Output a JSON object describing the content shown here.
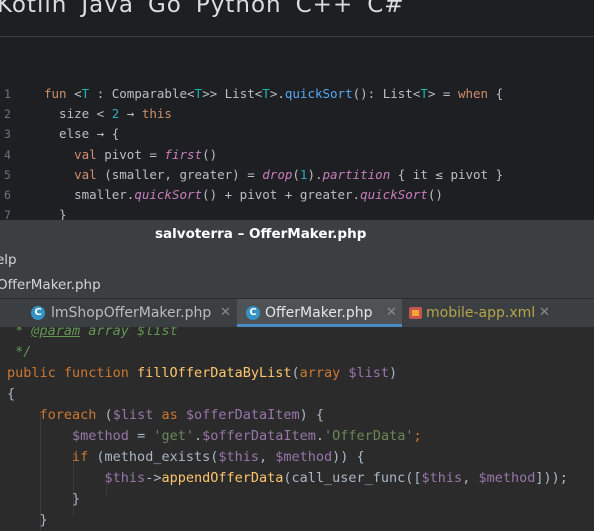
{
  "languages": [
    "Kotlin",
    "Java",
    "Go",
    "Python",
    "C++",
    "C#"
  ],
  "kotlin_snippet": {
    "line_numbers": [
      "1",
      "2",
      "3",
      "4",
      "5",
      "6",
      "7"
    ],
    "lines": [
      [
        {
          "t": "fun ",
          "c": "kw"
        },
        {
          "t": "<",
          "c": "pl"
        },
        {
          "t": "T",
          "c": "tp"
        },
        {
          "t": " : Comparable<",
          "c": "pl"
        },
        {
          "t": "T",
          "c": "tp"
        },
        {
          "t": ">> List<",
          "c": "pl"
        },
        {
          "t": "T",
          "c": "tp"
        },
        {
          "t": ">.",
          "c": "pl"
        },
        {
          "t": "quickSort",
          "c": "fn"
        },
        {
          "t": "(): List<",
          "c": "pl"
        },
        {
          "t": "T",
          "c": "tp"
        },
        {
          "t": "> = ",
          "c": "pl"
        },
        {
          "t": "when",
          "c": "kw"
        },
        {
          "t": " {",
          "c": "pl"
        }
      ],
      [
        {
          "t": "  size < ",
          "c": "pl"
        },
        {
          "t": "2",
          "c": "num"
        },
        {
          "t": " → ",
          "c": "pl"
        },
        {
          "t": "this",
          "c": "kw"
        }
      ],
      [
        {
          "t": "  else → {",
          "c": "pl"
        }
      ],
      [
        {
          "t": "    ",
          "c": "pl"
        },
        {
          "t": "val",
          "c": "kw"
        },
        {
          "t": " pivot = ",
          "c": "pl"
        },
        {
          "t": "first",
          "c": "it"
        },
        {
          "t": "()",
          "c": "pl"
        }
      ],
      [
        {
          "t": "    ",
          "c": "pl"
        },
        {
          "t": "val",
          "c": "kw"
        },
        {
          "t": " (smaller, greater) = ",
          "c": "pl"
        },
        {
          "t": "drop",
          "c": "it"
        },
        {
          "t": "(",
          "c": "pl"
        },
        {
          "t": "1",
          "c": "num"
        },
        {
          "t": ").",
          "c": "pl"
        },
        {
          "t": "partition",
          "c": "it"
        },
        {
          "t": " { it ≤ pivot }",
          "c": "pl"
        }
      ],
      [
        {
          "t": "    smaller.",
          "c": "pl"
        },
        {
          "t": "quickSort",
          "c": "it"
        },
        {
          "t": "() + pivot + greater.",
          "c": "pl"
        },
        {
          "t": "quickSort",
          "c": "it"
        },
        {
          "t": "()",
          "c": "pl"
        }
      ],
      [
        {
          "t": "  }",
          "c": "pl"
        }
      ]
    ]
  },
  "window": {
    "title": "salvoterra – OfferMaker.php",
    "menu_visible": "elp",
    "nav_breadcrumb": "OfferMaker.php"
  },
  "tabs": [
    {
      "label": "lmShopOfferMaker.php",
      "icon": "php-class-icon",
      "active": false
    },
    {
      "label": "OfferMaker.php",
      "icon": "php-class-icon",
      "active": true
    },
    {
      "label": "mobile-app.xml",
      "icon": "xml-file-icon",
      "active": false
    }
  ],
  "php_snippet": {
    "lines": [
      [
        {
          "t": " * ",
          "c": "cm"
        },
        {
          "t": "@param",
          "c": "tag"
        },
        {
          "t": " array $list",
          "c": "cm"
        }
      ],
      [
        {
          "t": " */",
          "c": "cm"
        }
      ],
      [
        {
          "t": "public function ",
          "c": "kw"
        },
        {
          "t": "fillOfferDataByList",
          "c": "fn"
        },
        {
          "t": "(",
          "c": "pl"
        },
        {
          "t": "array ",
          "c": "kw"
        },
        {
          "t": "$list",
          "c": "var"
        },
        {
          "t": ")",
          "c": "pl"
        }
      ],
      [
        {
          "t": "{",
          "c": "pl"
        }
      ],
      [
        {
          "t": "    ",
          "c": "pl"
        },
        {
          "t": "foreach ",
          "c": "kw"
        },
        {
          "t": "(",
          "c": "pl"
        },
        {
          "t": "$list ",
          "c": "var"
        },
        {
          "t": "as ",
          "c": "kw"
        },
        {
          "t": "$offerDataItem",
          "c": "var"
        },
        {
          "t": ") {",
          "c": "pl"
        }
      ],
      [
        {
          "t": "        ",
          "c": "pl"
        },
        {
          "t": "$method",
          "c": "var"
        },
        {
          "t": " = ",
          "c": "pl"
        },
        {
          "t": "'get'",
          "c": "str"
        },
        {
          "t": ".",
          "c": "pl"
        },
        {
          "t": "$offerDataItem",
          "c": "var"
        },
        {
          "t": ".",
          "c": "pl"
        },
        {
          "t": "'OfferData'",
          "c": "str"
        },
        {
          "t": ";",
          "c": "kw"
        }
      ],
      [
        {
          "t": "        ",
          "c": "pl"
        },
        {
          "t": "if ",
          "c": "kw"
        },
        {
          "t": "(method_exists(",
          "c": "pl"
        },
        {
          "t": "$this",
          "c": "var"
        },
        {
          "t": ", ",
          "c": "pl"
        },
        {
          "t": "$method",
          "c": "var"
        },
        {
          "t": ")) {",
          "c": "pl"
        }
      ],
      [
        {
          "t": "            ",
          "c": "pl"
        },
        {
          "t": "$this",
          "c": "var"
        },
        {
          "t": "->",
          "c": "pl"
        },
        {
          "t": "appendOfferData",
          "c": "fn"
        },
        {
          "t": "(call_user_func([",
          "c": "pl"
        },
        {
          "t": "$this",
          "c": "var"
        },
        {
          "t": ", ",
          "c": "pl"
        },
        {
          "t": "$method",
          "c": "var"
        },
        {
          "t": "]));",
          "c": "pl"
        }
      ],
      [
        {
          "t": "        }",
          "c": "pl"
        }
      ],
      [
        {
          "t": "    }",
          "c": "pl"
        }
      ]
    ]
  }
}
